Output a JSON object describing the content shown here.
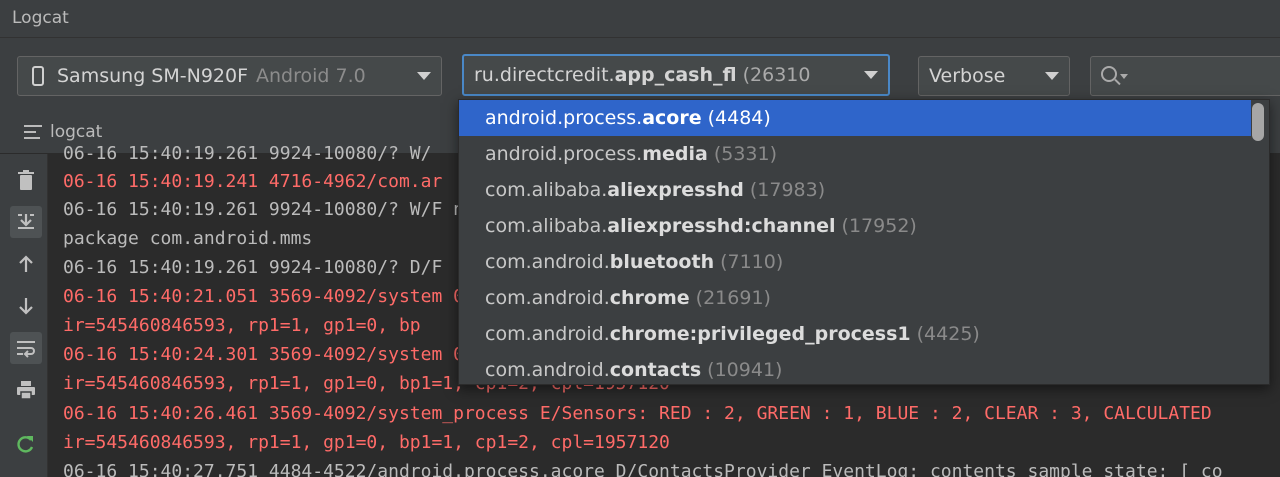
{
  "window": {
    "title": "Logcat"
  },
  "toolbar": {
    "device": {
      "name": "Samsung SM-N920F",
      "os": "Android 7.0"
    },
    "process": {
      "prefix": "ru.directcredit.",
      "bold": "app_cash_fl",
      "pid": "(26310"
    },
    "level": "Verbose",
    "search_placeholder": ""
  },
  "tab": {
    "label": "logcat"
  },
  "sidebar": {
    "icons": [
      "trash-icon",
      "scroll-to-end-icon",
      "up-arrow-icon",
      "down-arrow-icon",
      "soft-wrap-icon",
      "print-icon",
      "restart-icon"
    ]
  },
  "log_lines": [
    {
      "level": "w",
      "text": "06-16 15:40:19.261 9924-10080/? W/"
    },
    {
      "level": "e",
      "text": "06-16 15:40:19.241 4716-4962/com.ar"
    },
    {
      "level": "w",
      "text": "06-16 15:40:19.261 9924-10080/? W/F                                                                                   nm"
    },
    {
      "level": "n",
      "text": " package com.android.mms"
    },
    {
      "level": "d",
      "text": "06-16 15:40:19.261 9924-10080/? D/F"
    },
    {
      "level": "e",
      "text": "06-16 15:40:21.051 3569-4092/system                                                                                  0"
    },
    {
      "level": "e",
      "text": " ir=545460846593, rp1=1, gp1=0, bp"
    },
    {
      "level": "e",
      "text": "06-16 15:40:24.301 3569-4092/system                                                                                  0"
    },
    {
      "level": "e",
      "text": " ir=545460846593, rp1=1, gp1=0, bp1=1, cp1=2, cpl=1957120"
    },
    {
      "level": "e",
      "text": "06-16 15:40:26.461 3569-4092/system_process E/Sensors: RED : 2, GREEN : 1, BLUE : 2, CLEAR : 3, CALCULATED"
    },
    {
      "level": "e",
      "text": " ir=545460846593, rp1=1, gp1=0, bp1=1, cp1=2, cpl=1957120"
    },
    {
      "level": "d",
      "text": "06-16 15:40:27.751 4484-4522/android.process.acore D/ContactsProvider_EventLog: contents_sample_state: [ co"
    }
  ],
  "dropdown": {
    "items": [
      {
        "prefix": "android.process.",
        "bold": "acore",
        "pid": "(4484)",
        "selected": true
      },
      {
        "prefix": "android.process.",
        "bold": "media",
        "pid": "(5331)",
        "selected": false
      },
      {
        "prefix": "com.alibaba.",
        "bold": "aliexpresshd",
        "pid": "(17983)",
        "selected": false
      },
      {
        "prefix": "com.alibaba.",
        "bold": "aliexpresshd:channel",
        "pid": "(17952)",
        "selected": false
      },
      {
        "prefix": "com.android.",
        "bold": "bluetooth",
        "pid": "(7110)",
        "selected": false
      },
      {
        "prefix": "com.android.",
        "bold": "chrome",
        "pid": "(21691)",
        "selected": false
      },
      {
        "prefix": "com.android.",
        "bold": "chrome:privileged_process1",
        "pid": "(4425)",
        "selected": false
      },
      {
        "prefix": "com.android.",
        "bold": "contacts",
        "pid": "(10941)",
        "selected": false
      }
    ]
  },
  "colors": {
    "error": "#ff6b68",
    "selection": "#2f65ca",
    "focus_border": "#4a88c7",
    "panel": "#3c3f41",
    "editor": "#2b2b2b"
  }
}
